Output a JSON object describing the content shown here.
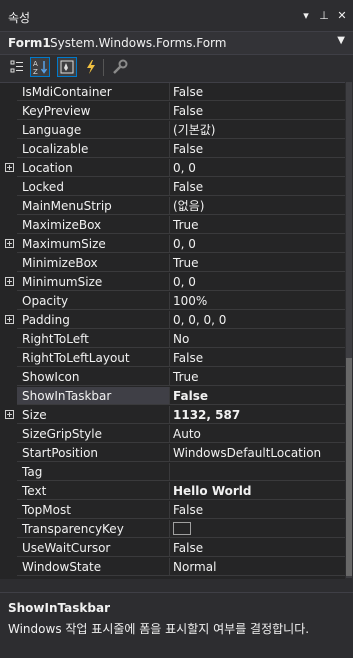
{
  "window": {
    "title": "속성"
  },
  "object_selector": {
    "name": "Form1",
    "type": "System.Windows.Forms.Form"
  },
  "toolbar": {
    "buttons": [
      {
        "icon": "categorized-icon"
      },
      {
        "icon": "alphabetical-icon",
        "active": true
      },
      {
        "icon": "properties-icon",
        "active": true
      },
      {
        "icon": "events-icon"
      },
      {
        "icon": "property-pages-icon"
      }
    ]
  },
  "properties": [
    {
      "name": "IsMdiContainer",
      "value": "False"
    },
    {
      "name": "KeyPreview",
      "value": "False"
    },
    {
      "name": "Language",
      "value": "(기본값)"
    },
    {
      "name": "Localizable",
      "value": "False"
    },
    {
      "name": "Location",
      "value": "0, 0",
      "expandable": true
    },
    {
      "name": "Locked",
      "value": "False"
    },
    {
      "name": "MainMenuStrip",
      "value": "(없음)"
    },
    {
      "name": "MaximizeBox",
      "value": "True"
    },
    {
      "name": "MaximumSize",
      "value": "0, 0",
      "expandable": true
    },
    {
      "name": "MinimizeBox",
      "value": "True"
    },
    {
      "name": "MinimumSize",
      "value": "0, 0",
      "expandable": true
    },
    {
      "name": "Opacity",
      "value": "100%"
    },
    {
      "name": "Padding",
      "value": "0, 0, 0, 0",
      "expandable": true
    },
    {
      "name": "RightToLeft",
      "value": "No"
    },
    {
      "name": "RightToLeftLayout",
      "value": "False"
    },
    {
      "name": "ShowIcon",
      "value": "True"
    },
    {
      "name": "ShowInTaskbar",
      "value": "False",
      "bold": true,
      "selected": true
    },
    {
      "name": "Size",
      "value": "1132, 587",
      "bold": true,
      "expandable": true
    },
    {
      "name": "SizeGripStyle",
      "value": "Auto"
    },
    {
      "name": "StartPosition",
      "value": "WindowsDefaultLocation"
    },
    {
      "name": "Tag",
      "value": ""
    },
    {
      "name": "Text",
      "value": "Hello World",
      "bold": true
    },
    {
      "name": "TopMost",
      "value": "False"
    },
    {
      "name": "TransparencyKey",
      "value": "",
      "swatch": true
    },
    {
      "name": "UseWaitCursor",
      "value": "False"
    },
    {
      "name": "WindowState",
      "value": "Normal"
    }
  ],
  "description": {
    "title": "ShowInTaskbar",
    "text": "Windows 작업 표시줄에 폼을 표시할지 여부를 결정합니다."
  },
  "colors": {
    "background": "#252526",
    "selection": "#3f3f46",
    "accent": "#007acc"
  }
}
